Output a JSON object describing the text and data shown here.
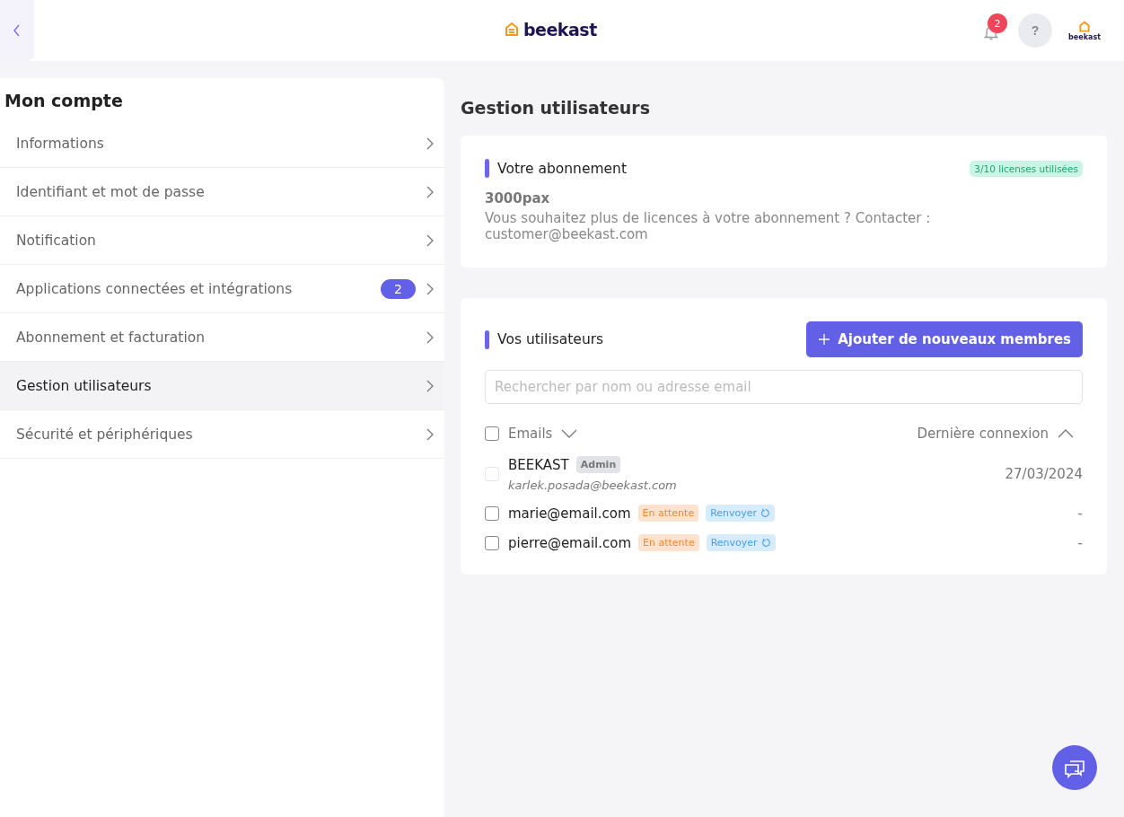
{
  "header": {
    "logo": "beekast",
    "notifications": "2",
    "help": "?",
    "account_logo": "beekast"
  },
  "sidebar": {
    "title": "Mon compte",
    "items": [
      {
        "label": "Informations",
        "selected": false
      },
      {
        "label": "Identifiant et mot de passe",
        "selected": false
      },
      {
        "label": "Notification",
        "selected": false
      },
      {
        "label": "Applications connectées et intégrations",
        "selected": false,
        "badge": "2"
      },
      {
        "label": "Abonnement et facturation",
        "selected": false
      },
      {
        "label": "Gestion utilisateurs",
        "selected": true
      },
      {
        "label": "Sécurité et périphériques",
        "selected": false
      }
    ]
  },
  "page_title": "Gestion utilisateurs",
  "subscription": {
    "title": "Votre abonnement",
    "licenses": "3/10 licenses utilisées",
    "plan": "3000pax",
    "note": "Vous souhaitez plus de licences à votre abonnement ? Contacter : customer@beekast.com"
  },
  "users": {
    "title": "Vos utilisateurs",
    "add_button": "Ajouter de nouveaux membres",
    "search": {
      "placeholder": "Rechercher par nom ou adresse email"
    },
    "header": {
      "checked": false,
      "emails": "Emails",
      "last_login": "Dernière connexion"
    },
    "rows": [
      {
        "name": "BEEKAST",
        "role": "Admin",
        "email": "karlek.posada@beekast.com",
        "last_login": "27/03/2024",
        "checked": false,
        "disabled": true
      },
      {
        "name": "marie@email.com",
        "status": "En attente",
        "resend": "Renvoyer",
        "last_login": "-",
        "checked": false,
        "disabled": false
      },
      {
        "name": "pierre@email.com",
        "status": "En attente",
        "resend": "Renvoyer",
        "last_login": "-",
        "checked": false,
        "disabled": false
      }
    ]
  }
}
